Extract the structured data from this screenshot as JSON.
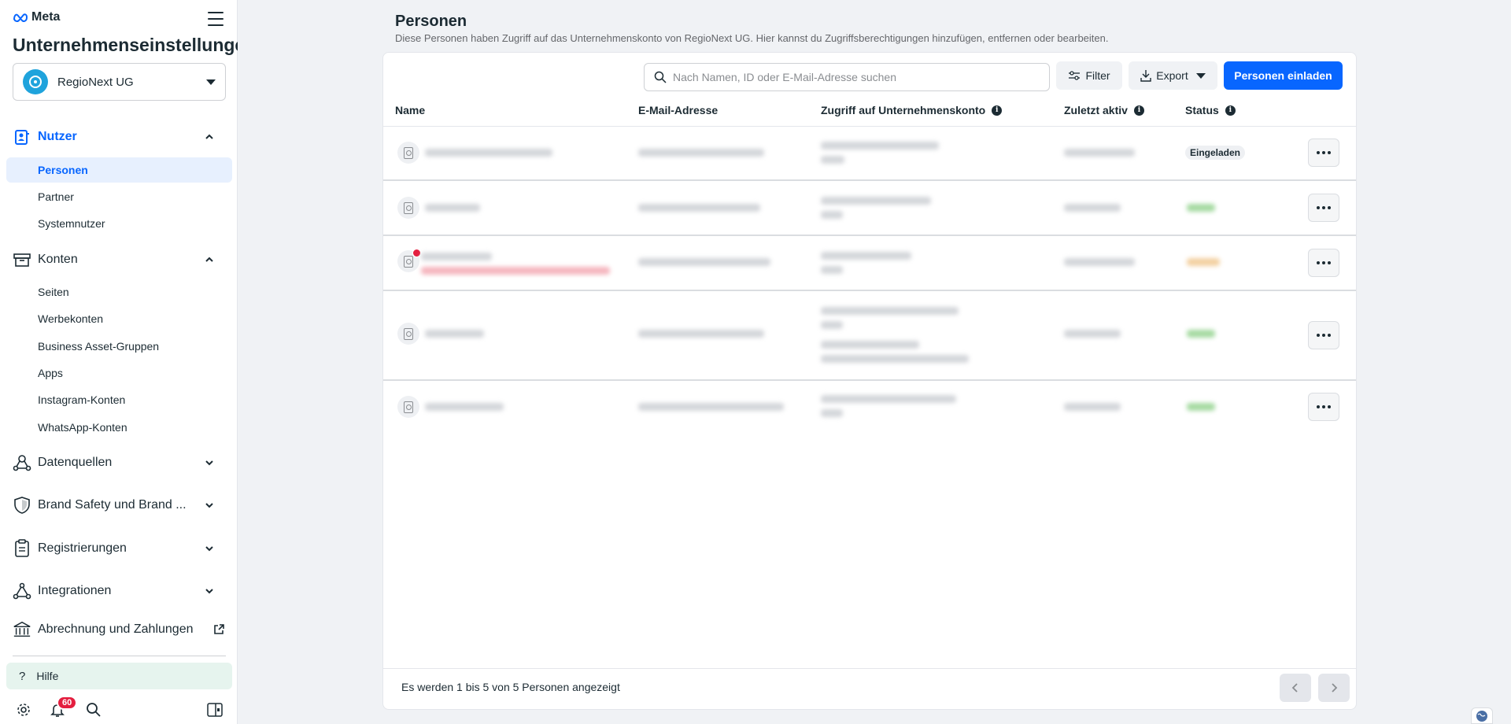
{
  "sidebar": {
    "brand": "Meta",
    "title": "Unternehmenseinstellungen",
    "account": "RegioNext UG",
    "sections": {
      "nutzer": "Nutzer",
      "konten": "Konten",
      "datenquellen": "Datenquellen",
      "brand_safety": "Brand Safety und Brand ...",
      "registrierungen": "Registrierungen",
      "integrationen": "Integrationen",
      "abrechnung": "Abrechnung und Zahlungen"
    },
    "nutzer_items": [
      "Personen",
      "Partner",
      "Systemnutzer"
    ],
    "konten_items": [
      "Seiten",
      "Werbekonten",
      "Business Asset-Gruppen",
      "Apps",
      "Instagram-Konten",
      "WhatsApp-Konten"
    ],
    "help": "Hilfe",
    "notifications_count": "60"
  },
  "main": {
    "title": "Personen",
    "description": "Diese Personen haben Zugriff auf das Unternehmenskonto von RegioNext UG. Hier kannst du Zugriffsberechtigungen hinzufügen, entfernen oder bearbeiten.",
    "search_placeholder": "Nach Namen, ID oder E-Mail-Adresse suchen",
    "filter_label": "Filter",
    "export_label": "Export",
    "invite_label": "Personen einladen",
    "columns": {
      "name": "Name",
      "email": "E-Mail-Adresse",
      "access": "Zugriff auf Unternehmenskonto",
      "last_active": "Zuletzt aktiv",
      "status": "Status"
    },
    "rows": [
      {
        "status": "Eingeladen",
        "status_color": "#eef0f3"
      },
      {
        "status": "",
        "status_color": "#8fd18a"
      },
      {
        "status": "",
        "status_color": "#f0c58a"
      },
      {
        "status": "",
        "status_color": "#8fd18a"
      },
      {
        "status": "",
        "status_color": "#8fd18a"
      }
    ],
    "footer": "Es werden 1 bis 5 von 5 Personen angezeigt"
  },
  "colors": {
    "primary": "#0866ff",
    "active_bg": "#e7f0fe",
    "help_bg": "#e6f4ee",
    "badge_red": "#e41e3f"
  }
}
